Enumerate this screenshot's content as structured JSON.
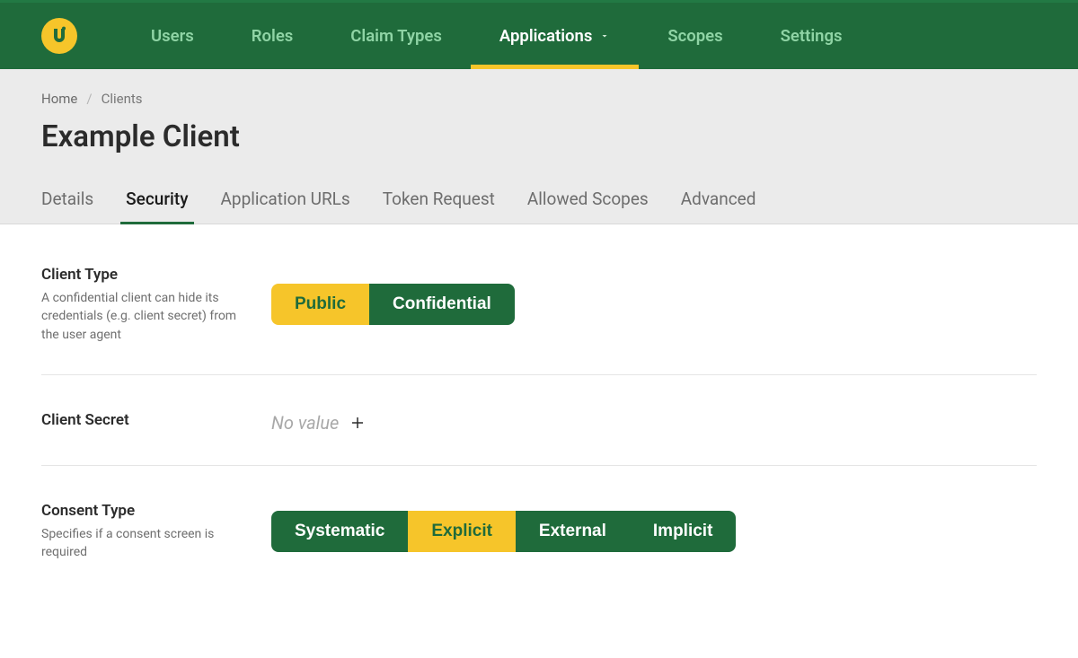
{
  "nav": [
    {
      "label": "Users",
      "active": false,
      "dropdown": false
    },
    {
      "label": "Roles",
      "active": false,
      "dropdown": false
    },
    {
      "label": "Claim Types",
      "active": false,
      "dropdown": false
    },
    {
      "label": "Applications",
      "active": true,
      "dropdown": true
    },
    {
      "label": "Scopes",
      "active": false,
      "dropdown": false
    },
    {
      "label": "Settings",
      "active": false,
      "dropdown": false
    }
  ],
  "breadcrumb": [
    {
      "label": "Home",
      "current": false
    },
    {
      "label": "Clients",
      "current": true
    }
  ],
  "page_title": "Example Client",
  "tabs": [
    {
      "label": "Details",
      "active": false
    },
    {
      "label": "Security",
      "active": true
    },
    {
      "label": "Application URLs",
      "active": false
    },
    {
      "label": "Token Request",
      "active": false
    },
    {
      "label": "Allowed Scopes",
      "active": false
    },
    {
      "label": "Advanced",
      "active": false
    }
  ],
  "fields": {
    "client_type": {
      "title": "Client Type",
      "help": "A confidential client can hide its credentials (e.g. client secret) from the user agent",
      "options": [
        {
          "label": "Public",
          "selected": true
        },
        {
          "label": "Confidential",
          "selected": false
        }
      ]
    },
    "client_secret": {
      "title": "Client Secret",
      "value_placeholder": "No value"
    },
    "consent_type": {
      "title": "Consent Type",
      "help": "Specifies if a consent screen is required",
      "options": [
        {
          "label": "Systematic",
          "selected": false
        },
        {
          "label": "Explicit",
          "selected": true
        },
        {
          "label": "External",
          "selected": false
        },
        {
          "label": "Implicit",
          "selected": false
        }
      ]
    }
  }
}
